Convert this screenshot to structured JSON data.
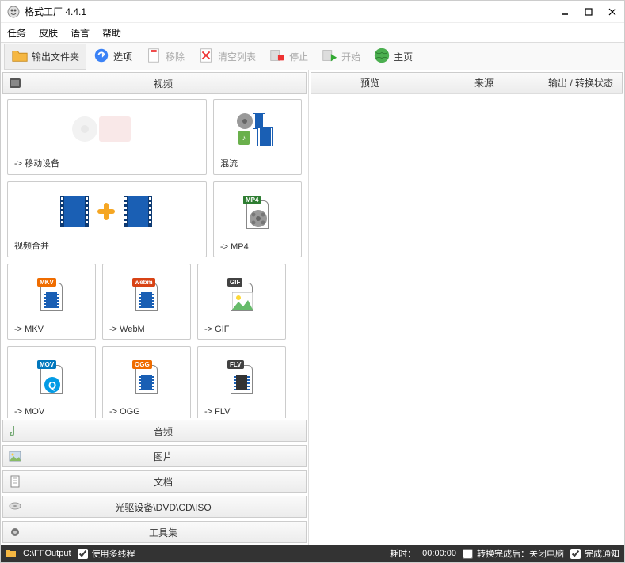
{
  "app": {
    "title": "格式工厂 4.4.1"
  },
  "menu": {
    "task": "任务",
    "skin": "皮肤",
    "lang": "语言",
    "help": "帮助"
  },
  "toolbar": {
    "output": "输出文件夹",
    "options": "选项",
    "remove": "移除",
    "clear": "清空列表",
    "stop": "停止",
    "start": "开始",
    "home": "主页"
  },
  "categories": {
    "video": "视频",
    "audio": "音频",
    "picture": "图片",
    "document": "文档",
    "rom": "光驱设备\\DVD\\CD\\ISO",
    "tools": "工具集"
  },
  "tiles": {
    "mobile": "-> 移动设备",
    "mux": "混流",
    "join": "视频合并",
    "mp4": "-> MP4",
    "mkv": "-> MKV",
    "webm": "-> WebM",
    "gif": "-> GIF",
    "mov": "-> MOV",
    "ogg": "-> OGG",
    "flv": "-> FLV"
  },
  "tags": {
    "mp4": "MP4",
    "mkv": "MKV",
    "webm": "webm",
    "gif": "GIF",
    "mov": "MOV",
    "ogg": "OGG",
    "flv": "FLV"
  },
  "right": {
    "preview": "预览",
    "source": "来源",
    "status": "输出 / 转换状态"
  },
  "status": {
    "path": "C:\\FFOutput",
    "multithread": "使用多线程",
    "elapsed_label": "耗时：",
    "elapsed_value": "00:00:00",
    "shutdown": "转换完成后：关闭电脑",
    "notify": "完成通知"
  },
  "colors": {
    "mp4": "#2e7d32",
    "mkv": "#ef6c00",
    "webm": "#d84315",
    "gif": "#424242",
    "mov": "#0277bd",
    "ogg": "#ef6c00",
    "flv": "#424242"
  }
}
